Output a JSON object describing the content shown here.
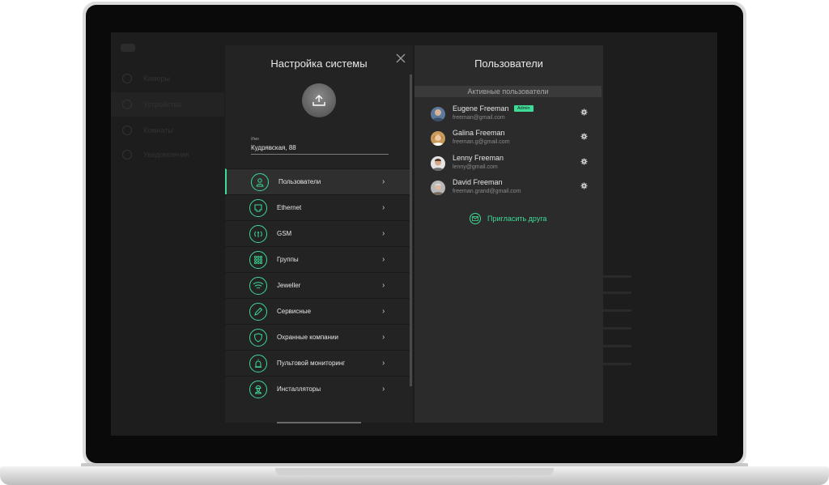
{
  "background_app": {
    "sidebar_items": [
      "Камеры",
      "Устройства",
      "Комнаты",
      "Уведомления"
    ]
  },
  "settings": {
    "title": "Настройка системы",
    "name_label": "Имя",
    "name_value": "Кудрявская, 88",
    "menu": [
      {
        "label": "Пользователи",
        "icon": "user-icon"
      },
      {
        "label": "Ethernet",
        "icon": "ethernet-icon"
      },
      {
        "label": "GSM",
        "icon": "gsm-icon"
      },
      {
        "label": "Группы",
        "icon": "groups-icon"
      },
      {
        "label": "Jeweller",
        "icon": "jeweller-icon"
      },
      {
        "label": "Сервисные",
        "icon": "pencil-icon"
      },
      {
        "label": "Охранные компании",
        "icon": "shield-icon"
      },
      {
        "label": "Пультовой мониторинг",
        "icon": "siren-icon"
      },
      {
        "label": "Инсталляторы",
        "icon": "installer-icon"
      }
    ]
  },
  "users": {
    "title": "Пользователи",
    "section_title": "Активные пользователи",
    "list": [
      {
        "name": "Eugene Freeman",
        "email": "freeman@gmail.com",
        "badge": "Admin"
      },
      {
        "name": "Galina Freeman",
        "email": "freeman.g@gmail.com"
      },
      {
        "name": "Lenny Freeman",
        "email": "lenny@gmail.com"
      },
      {
        "name": "David Freeman",
        "email": "freeman.grand@gmail.com"
      }
    ],
    "invite_label": "Пригласить друга"
  },
  "colors": {
    "accent": "#3ddc97",
    "panel_dark": "#232323",
    "panel_users": "#2b2b2b"
  }
}
